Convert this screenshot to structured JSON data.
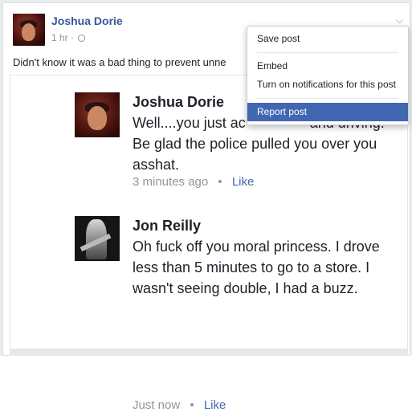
{
  "post": {
    "author": "Joshua Dorie",
    "timestamp": "1 hr",
    "privacy_separator": "·",
    "caption": "Didn't know it was a bad thing to prevent unne"
  },
  "menu": {
    "items": [
      {
        "label": "Save post"
      },
      {
        "label": "Embed"
      },
      {
        "label": "Turn on notifications for this post"
      },
      {
        "label": "Report post"
      }
    ]
  },
  "screenshot": {
    "comments": [
      {
        "name": "Joshua Dorie",
        "text": "Well....you just ac                and driving. Be glad the police pulled you over you asshat.",
        "time": "3 minutes ago",
        "like": "Like"
      },
      {
        "name": "Jon Reilly",
        "text": "Oh fuck off you moral princess. I drove less than 5 minutes to go to a store. I wasn't seeing double, I had a buzz.",
        "time": "Just now",
        "like": "Like"
      }
    ],
    "dot": "•"
  },
  "icons": {
    "chevron": "chevron-down-icon",
    "globe": "globe-icon"
  },
  "colors": {
    "link": "#365899",
    "menu_highlight": "#4267b2",
    "muted": "#90949c"
  }
}
